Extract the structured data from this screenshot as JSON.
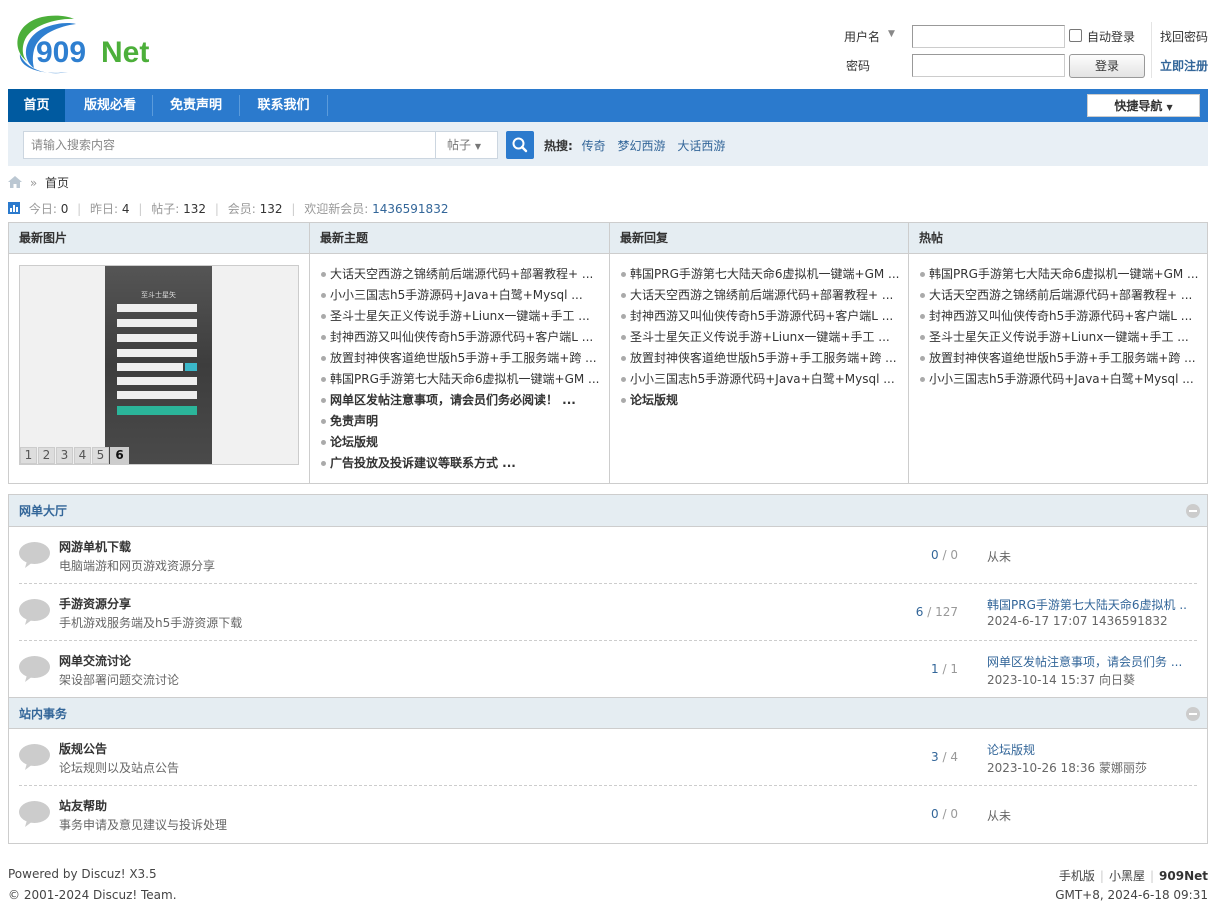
{
  "brand": {
    "logo_text": "909Net"
  },
  "login": {
    "username_label": "用户名",
    "password_label": "密码",
    "auto_login_label": "自动登录",
    "login_button": "登录",
    "find_password": "找回密码",
    "register": "立即注册"
  },
  "nav": {
    "items": [
      {
        "label": "首页"
      },
      {
        "label": "版规必看"
      },
      {
        "label": "免责声明"
      },
      {
        "label": "联系我们"
      }
    ],
    "quick_nav": "快捷导航"
  },
  "search": {
    "placeholder": "请输入搜索内容",
    "type": "帖子",
    "hot_label": "热搜:",
    "hot_words": [
      "传奇",
      "梦幻西游",
      "大话西游"
    ]
  },
  "breadcrumb": {
    "current": "首页"
  },
  "stats": {
    "today_label": "今日:",
    "today": "0",
    "yesterday_label": "昨日:",
    "yesterday": "4",
    "posts_label": "帖子:",
    "posts": "132",
    "members_label": "会员:",
    "members": "132",
    "welcome_label": "欢迎新会员:",
    "newest_member": "1436591832"
  },
  "portal": {
    "pictures": {
      "title": "最新图片",
      "image_title": "至斗士星矢",
      "pages": [
        "1",
        "2",
        "3",
        "4",
        "5",
        "6"
      ]
    },
    "latest_topics": {
      "title": "最新主题",
      "items": [
        "大话天空西游之锦绣前后端源代码+部署教程+ ...",
        "小小三国志h5手游源码+Java+白鹭+Mysql ...",
        "圣斗士星矢正义传说手游+Liunx一键端+手工 ...",
        "封神西游又叫仙侠传奇h5手游源代码+客户端L ...",
        "放置封神侠客道绝世版h5手游+手工服务端+跨 ...",
        "韩国PRG手游第七大陆天命6虚拟机一键端+GM ...",
        "网单区发帖注意事项，请会员们务必阅读！ ...",
        "免责声明",
        "论坛版规",
        "广告投放及投诉建议等联系方式 ..."
      ]
    },
    "latest_replies": {
      "title": "最新回复",
      "items": [
        "韩国PRG手游第七大陆天命6虚拟机一键端+GM ...",
        "大话天空西游之锦绣前后端源代码+部署教程+ ...",
        "封神西游又叫仙侠传奇h5手游源代码+客户端L ...",
        "圣斗士星矢正义传说手游+Liunx一键端+手工 ...",
        "放置封神侠客道绝世版h5手游+手工服务端+跨 ...",
        "小小三国志h5手游源代码+Java+白鹭+Mysql ...",
        "论坛版规"
      ]
    },
    "hot": {
      "title": "热帖",
      "items": [
        "韩国PRG手游第七大陆天命6虚拟机一键端+GM ...",
        "大话天空西游之锦绣前后端源代码+部署教程+ ...",
        "封神西游又叫仙侠传奇h5手游源代码+客户端L ...",
        "圣斗士星矢正义传说手游+Liunx一键端+手工 ...",
        "放置封神侠客道绝世版h5手游+手工服务端+跨 ...",
        "小小三国志h5手游源代码+Java+白鹭+Mysql ..."
      ]
    }
  },
  "sections": [
    {
      "title": "网单大厅",
      "forums": [
        {
          "name": "网游单机下载",
          "desc": "电脑端游和网页游戏资源分享",
          "threads": "0",
          "posts": "0",
          "last_never": "从未"
        },
        {
          "name": "手游资源分享",
          "desc": "手机游戏服务端及h5手游资源下载",
          "threads": "6",
          "posts": "127",
          "last_title": "韩国PRG手游第七大陆天命6虚拟机 ...",
          "last_meta": "2024-6-17 17:07 1436591832"
        },
        {
          "name": "网单交流讨论",
          "desc": "架设部署问题交流讨论",
          "threads": "1",
          "posts": "1",
          "last_title": "网单区发帖注意事项，请会员们务 ...",
          "last_meta": "2023-10-14 15:37 向日葵"
        }
      ]
    },
    {
      "title": "站内事务",
      "forums": [
        {
          "name": "版规公告",
          "desc": "论坛规则以及站点公告",
          "threads": "3",
          "posts": "4",
          "last_title": "论坛版规",
          "last_meta": "2023-10-26 18:36 蒙娜丽莎"
        },
        {
          "name": "站友帮助",
          "desc": "事务申请及意见建议与投诉处理",
          "threads": "0",
          "posts": "0",
          "last_never": "从未"
        }
      ]
    }
  ],
  "footer": {
    "powered": "Powered by Discuz! X3.5",
    "copyright": "© 2001-2024 Discuz! Team.",
    "mobile": "手机版",
    "blackroom": "小黑屋",
    "site": "909Net",
    "time": "GMT+8, 2024-6-18 09:31"
  },
  "colors": {
    "nav": "#2b7acd",
    "nav_active": "#005aa0",
    "link": "#336699",
    "head_bg": "#e5edf2"
  }
}
